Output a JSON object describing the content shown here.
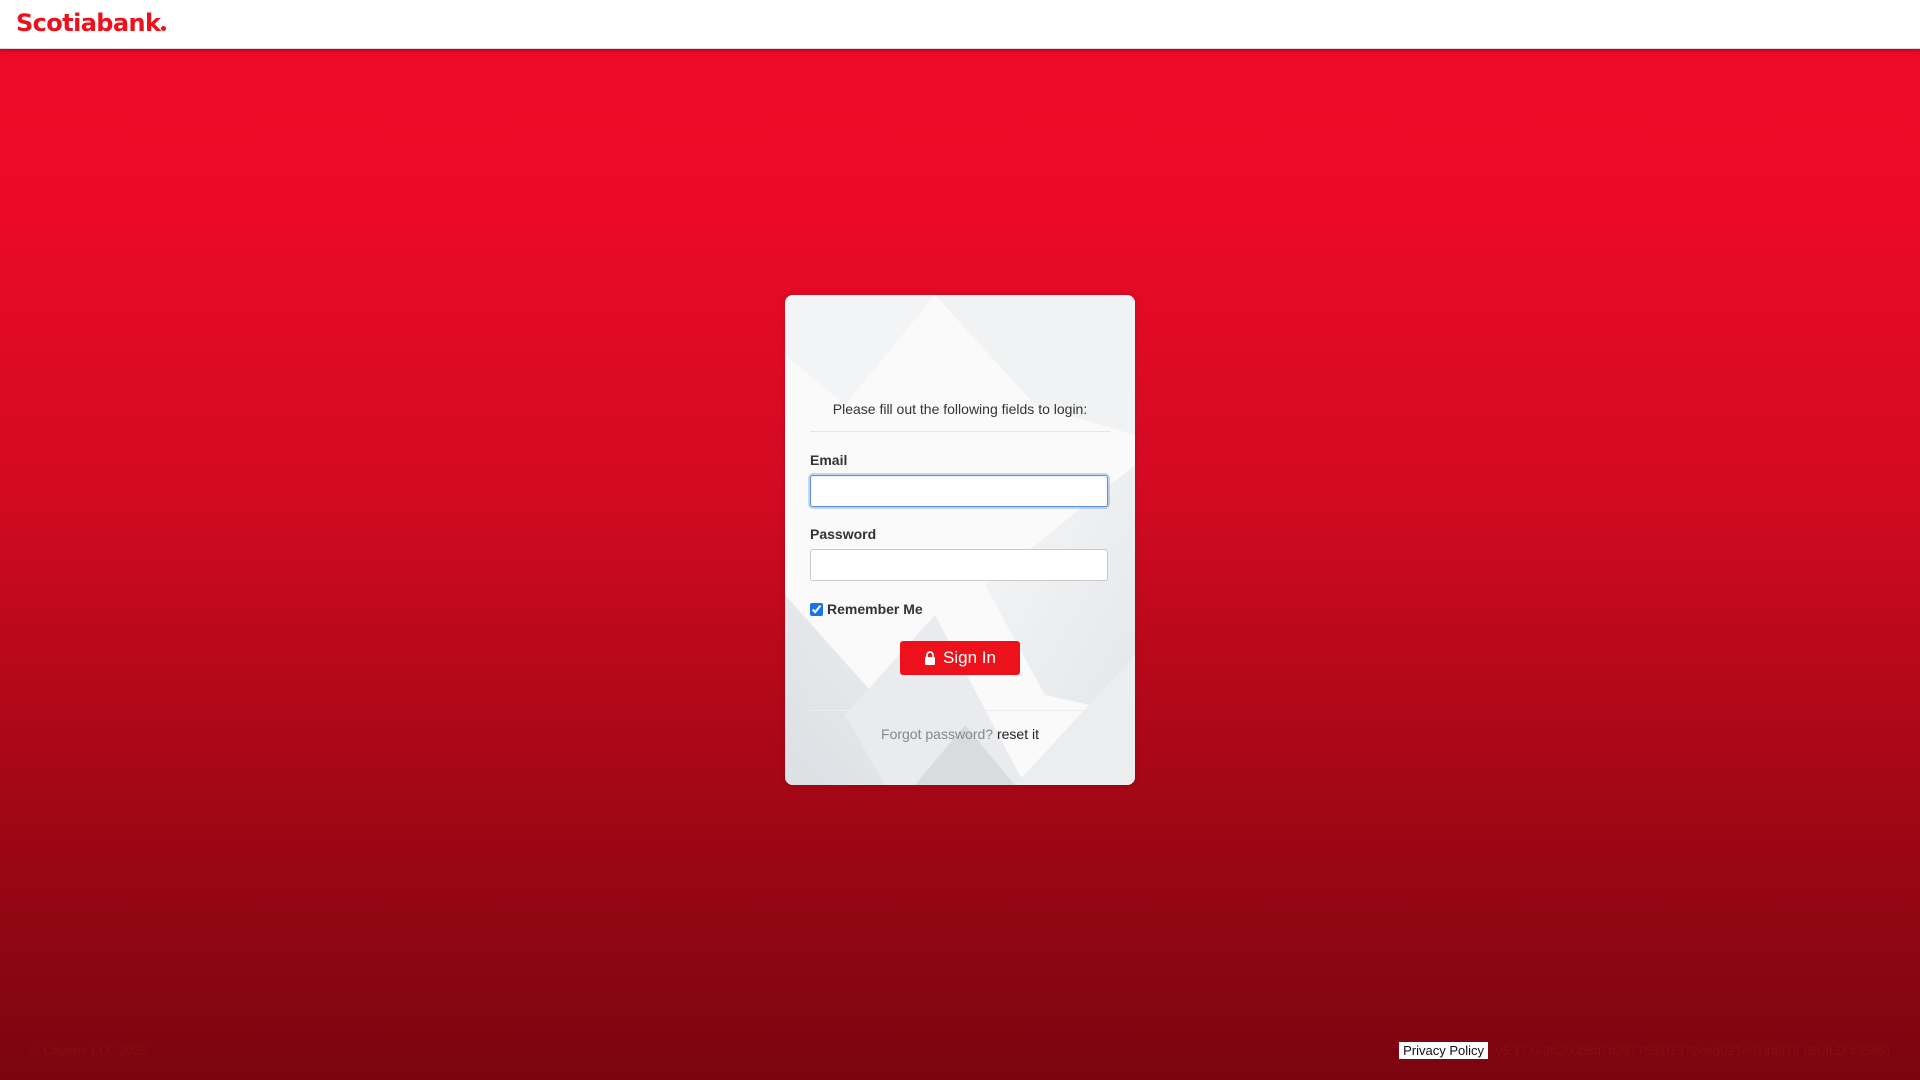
{
  "header": {
    "brand": "Scotiabank"
  },
  "login": {
    "prompt": "Please fill out the following fields to login:",
    "email_label": "Email",
    "email_value": "",
    "password_label": "Password",
    "password_value": "",
    "remember_label": "Remember Me",
    "remember_checked": true,
    "signin_label": "Sign In",
    "forgot_text": "Forgot password?",
    "reset_label": "reset it"
  },
  "footer": {
    "copyright": "© Cavane LLC 2025",
    "privacy_label": "Privacy Policy",
    "version": "v5.17.0-3b2b0b8d7b2977581f1372eed021e914a919 (BUILD #3586)"
  },
  "colors": {
    "brand_red": "#ec111a",
    "background_top": "#ee0a28",
    "background_bottom": "#7a050f",
    "focus_ring": "#5b8fd6"
  },
  "icons": {
    "signin": "lock-icon"
  }
}
